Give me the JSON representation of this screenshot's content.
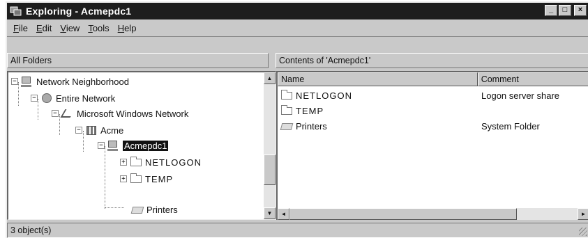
{
  "window": {
    "title": "Exploring - Acmepdc1"
  },
  "title_buttons": {
    "minimize": "_",
    "maximize": "□",
    "close": "×"
  },
  "menu": [
    {
      "accel": "F",
      "rest": "ile"
    },
    {
      "accel": "E",
      "rest": "dit"
    },
    {
      "accel": "V",
      "rest": "iew"
    },
    {
      "accel": "T",
      "rest": "ools"
    },
    {
      "accel": "H",
      "rest": "elp"
    }
  ],
  "left_pane": {
    "header": "All Folders"
  },
  "right_pane": {
    "header": "Contents of 'Acmepdc1'"
  },
  "tree": [
    {
      "label": "Network Neighborhood",
      "icon": "network-neighborhood-icon",
      "expander": "−"
    },
    {
      "label": "Entire Network",
      "icon": "globe-icon",
      "expander": "−"
    },
    {
      "label": "Microsoft Windows Network",
      "icon": "network-icon",
      "expander": "−"
    },
    {
      "label": "Acme",
      "icon": "domain-icon",
      "expander": "−"
    },
    {
      "label": "Acmepdc1",
      "icon": "computer-icon",
      "expander": "−",
      "selected": true
    },
    {
      "label": "NETLOGON",
      "icon": "folder-icon",
      "expander": "+"
    },
    {
      "label": "TEMP",
      "icon": "folder-icon",
      "expander": "+"
    },
    {
      "label": "Printers",
      "icon": "printer-icon",
      "expander": ""
    }
  ],
  "columns": {
    "name": "Name",
    "comment": "Comment"
  },
  "contents": [
    {
      "name": "NETLOGON",
      "comment": "Logon server share",
      "icon": "folder-icon"
    },
    {
      "name": "TEMP",
      "comment": "",
      "icon": "folder-icon"
    },
    {
      "name": "Printers",
      "comment": "System Folder",
      "icon": "printer-icon"
    }
  ],
  "status": {
    "text": "3 object(s)"
  },
  "scroll_arrows": {
    "up": "▲",
    "down": "▼",
    "left": "◄",
    "right": "►"
  }
}
